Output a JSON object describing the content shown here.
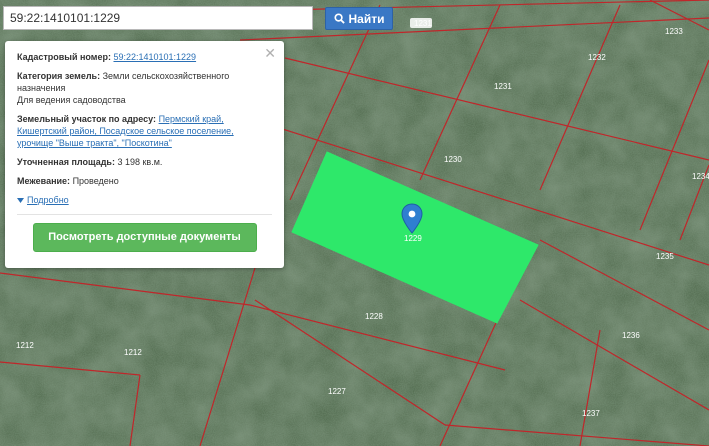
{
  "search": {
    "value": "59:22:1410101:1229",
    "button_label": "Найти"
  },
  "popup": {
    "cadastral_label": "Кадастровый номер:",
    "cadastral_value": "59:22:1410101:1229",
    "category_label": "Категория земель:",
    "category_value": "Земли сельскохозяйственного назначения",
    "usage_value": "Для ведения садоводства",
    "address_label": "Земельный участок по адресу:",
    "address_value": "Пермский край, Кишертский район, Посадское сельское поселение, урочище \"Выше тракта\", \"Поскотина\"",
    "area_label": "Уточненная площадь:",
    "area_value": "3 198 кв.м.",
    "survey_label": "Межевание:",
    "survey_value": "Проведено",
    "more_link": "Подробно",
    "docs_button": "Посмотреть доступные документы"
  },
  "map": {
    "parcel_labels": [
      "1231",
      "1233",
      "1232",
      "1231",
      "1230",
      "1234",
      "1229",
      "1235",
      "1228",
      "1236",
      "1212",
      "1212",
      "1227",
      "1237",
      "1229"
    ],
    "highlight_color": "#2ee86a",
    "border_color": "#c0262a",
    "marker_color": "#2f7fd0"
  }
}
